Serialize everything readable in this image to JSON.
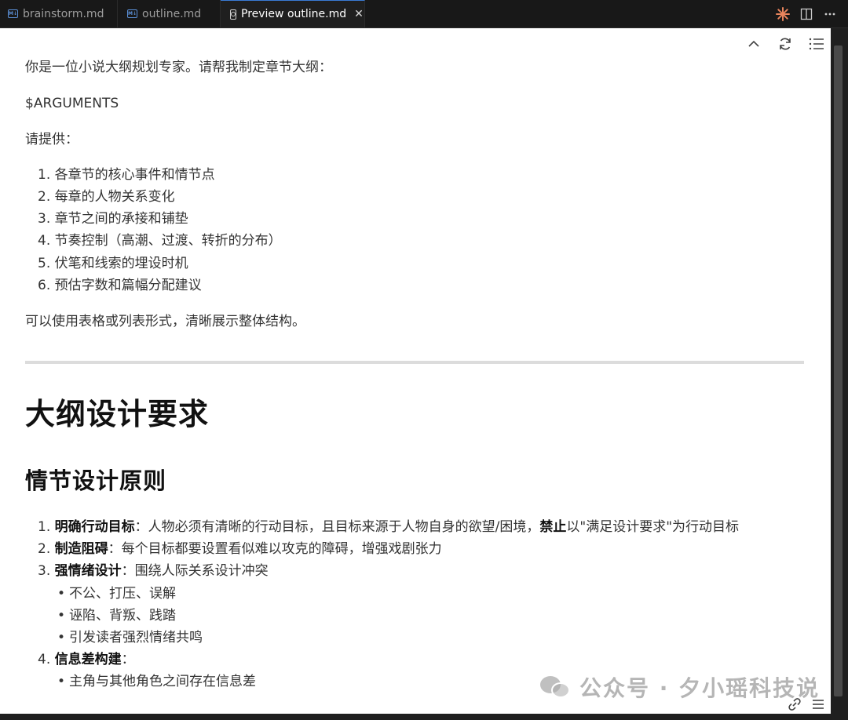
{
  "tabs": [
    {
      "label": "brainstorm.md",
      "icon": "markdown-icon"
    },
    {
      "label": "outline.md",
      "icon": "markdown-icon"
    },
    {
      "label": "Preview outline.md",
      "icon": "preview-icon",
      "active": true
    }
  ],
  "colors": {
    "accent": "#3a7bd5",
    "tab_bg": "#181818",
    "editor_bg": "#ffffff",
    "spark": "#e8845c"
  },
  "doc": {
    "intro": "你是一位小说大纲规划专家。请帮我制定章节大纲：",
    "arguments": "$ARGUMENTS",
    "please_provide": "请提供：",
    "request_list": [
      "各章节的核心事件和情节点",
      "每章的人物关系变化",
      "章节之间的承接和铺垫",
      "节奏控制（高潮、过渡、转折的分布）",
      "伏笔和线索的埋设时机",
      "预估字数和篇幅分配建议"
    ],
    "closing": "可以使用表格或列表形式，清晰展示整体结构。",
    "h1": "大纲设计要求",
    "h2": "情节设计原则",
    "principles": [
      {
        "num": "1.",
        "bold": "明确行动目标",
        "text_a": "：人物必须有清晰的行动目标，且目标来源于人物自身的欲望/困境，",
        "bold2": "禁止",
        "text_b": "以\"满足设计要求\"为行动目标"
      },
      {
        "num": "2.",
        "bold": "制造阻碍",
        "text_a": "：每个目标都要设置看似难以攻克的障碍，增强戏剧张力"
      },
      {
        "num": "3.",
        "bold": "强情绪设计",
        "text_a": "：围绕人际关系设计冲突",
        "sub": [
          "不公、打压、误解",
          "诬陷、背叛、践踏",
          "引发读者强烈情绪共鸣"
        ]
      },
      {
        "num": "4.",
        "bold": "信息差构建",
        "text_a": "：",
        "sub": [
          "主角与其他角色之间存在信息差"
        ]
      }
    ]
  },
  "watermark": "公众号 · 夕小瑶科技说"
}
